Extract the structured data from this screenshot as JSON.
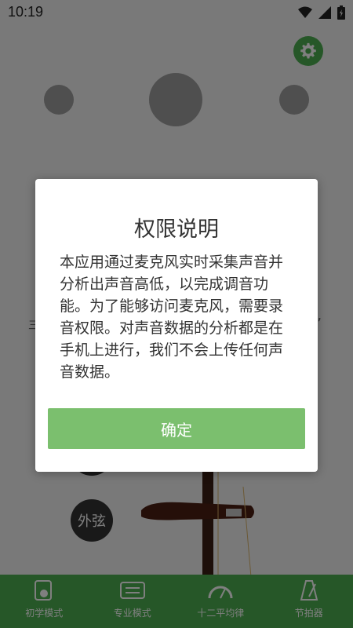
{
  "status_bar": {
    "time": "10:19",
    "icons": [
      "wifi-icon",
      "signal-icon",
      "battery-icon"
    ]
  },
  "main": {
    "tip_right": "”",
    "tip_left": "三",
    "strings": {
      "inner": "",
      "outer": "外弦"
    }
  },
  "dialog": {
    "title": "权限说明",
    "body": "本应用通过麦克风实时采集声音并分析出声音高低，以完成调音功能。为了能够访问麦克风，需要录音权限。对声音数据的分析都是在手机上进行，我们不会上传任何声音数据。",
    "confirm_label": "确定"
  },
  "bottom_nav": {
    "items": [
      {
        "label": "初学模式",
        "icon": "beginner-mode-icon"
      },
      {
        "label": "专业模式",
        "icon": "pro-mode-icon"
      },
      {
        "label": "十二平均律",
        "icon": "gauge-icon"
      },
      {
        "label": "节拍器",
        "icon": "metronome-icon"
      }
    ]
  },
  "colors": {
    "accent": "#4caf50",
    "confirm": "#7bbf6e",
    "overlay": "rgba(0,0,0,0.5)"
  }
}
